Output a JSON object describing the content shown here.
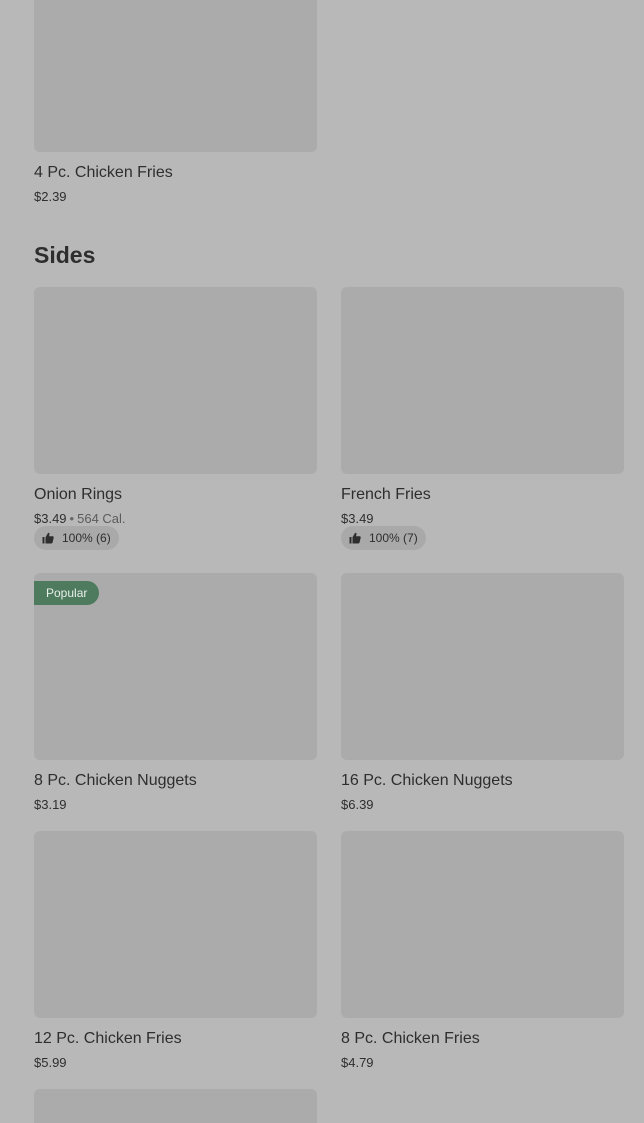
{
  "top_item": {
    "title": "4 Pc. Chicken Fries",
    "price": "$2.39"
  },
  "section": {
    "title": "Sides"
  },
  "items": [
    {
      "title": "Onion Rings",
      "price": "$3.49",
      "separator": "•",
      "calories": "564 Cal.",
      "rating": "100% (6)",
      "icon": "thumbs-up-icon"
    },
    {
      "title": "French Fries",
      "price": "$3.49",
      "rating": "100% (7)",
      "icon": "thumbs-up-icon"
    },
    {
      "title": "8 Pc. Chicken Nuggets",
      "price": "$3.19",
      "badge": "Popular"
    },
    {
      "title": "16 Pc. Chicken Nuggets",
      "price": "$6.39"
    },
    {
      "title": "12 Pc. Chicken Fries",
      "price": "$5.99"
    },
    {
      "title": "8 Pc. Chicken Fries",
      "price": "$4.79"
    }
  ],
  "colors": {
    "page_overlay": "#b8b8b8",
    "image_placeholder": "#ababab",
    "badge_popular": "#4e7a5e",
    "text": "#2e2e2e"
  }
}
